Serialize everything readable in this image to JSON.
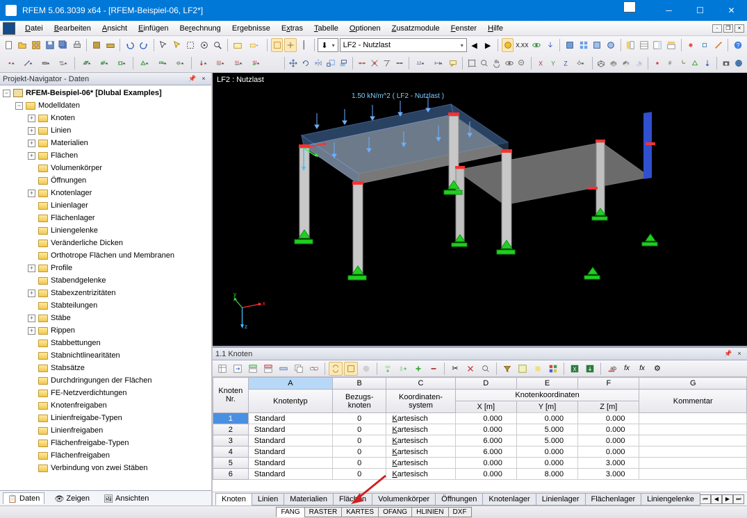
{
  "title": "RFEM 5.06.3039 x64 - [RFEM-Beispiel-06, LF2*]",
  "menus": [
    "Datei",
    "Bearbeiten",
    "Ansicht",
    "Einfügen",
    "Berechnung",
    "Ergebnisse",
    "Extras",
    "Tabelle",
    "Optionen",
    "Zusatzmodule",
    "Fenster",
    "Hilfe"
  ],
  "combo_load": "LF2 - Nutzlast",
  "nav_header": "Projekt-Navigator - Daten",
  "tree_root": "RFEM-Beispiel-06* [Dlubal Examples]",
  "tree_modelldaten": "Modelldaten",
  "tree_items": [
    {
      "label": "Knoten",
      "exp": "+"
    },
    {
      "label": "Linien",
      "exp": "+"
    },
    {
      "label": "Materialien",
      "exp": "+"
    },
    {
      "label": "Flächen",
      "exp": "+"
    },
    {
      "label": "Volumenkörper",
      "exp": ""
    },
    {
      "label": "Öffnungen",
      "exp": ""
    },
    {
      "label": "Knotenlager",
      "exp": "+"
    },
    {
      "label": "Linienlager",
      "exp": ""
    },
    {
      "label": "Flächenlager",
      "exp": ""
    },
    {
      "label": "Liniengelenke",
      "exp": ""
    },
    {
      "label": "Veränderliche Dicken",
      "exp": ""
    },
    {
      "label": "Orthotrope Flächen und Membranen",
      "exp": ""
    },
    {
      "label": "Profile",
      "exp": "+"
    },
    {
      "label": "Stabendgelenke",
      "exp": ""
    },
    {
      "label": "Stabexzentrizitäten",
      "exp": "+"
    },
    {
      "label": "Stabteilungen",
      "exp": ""
    },
    {
      "label": "Stäbe",
      "exp": "+"
    },
    {
      "label": "Rippen",
      "exp": "+"
    },
    {
      "label": "Stabbettungen",
      "exp": ""
    },
    {
      "label": "Stabnichtlinearitäten",
      "exp": ""
    },
    {
      "label": "Stabsätze",
      "exp": ""
    },
    {
      "label": "Durchdringungen der Flächen",
      "exp": ""
    },
    {
      "label": "FE-Netzverdichtungen",
      "exp": ""
    },
    {
      "label": "Knotenfreigaben",
      "exp": ""
    },
    {
      "label": "Linienfreigabe-Typen",
      "exp": ""
    },
    {
      "label": "Linienfreigaben",
      "exp": ""
    },
    {
      "label": "Flächenfreigabe-Typen",
      "exp": ""
    },
    {
      "label": "Flächenfreigaben",
      "exp": ""
    },
    {
      "label": "Verbindung von zwei Stäben",
      "exp": ""
    }
  ],
  "nav_tabs": [
    "Daten",
    "Zeigen",
    "Ansichten"
  ],
  "viewport_label": "LF2 : Nutzlast",
  "viewport_load_text": "1.50 kN/m^2 ( LF2 - Nutzlast )",
  "axis": {
    "x": "x",
    "y": "y",
    "z": "z"
  },
  "table_header": "1.1 Knoten",
  "table_columns": {
    "rowhdr": "Knoten\nNr.",
    "A_top": "A",
    "A": "Knotentyp",
    "B_top": "B",
    "B": "Bezugs-\nknoten",
    "C_top": "C",
    "C": "Koordinaten-\nsystem",
    "D_top": "D",
    "E_top": "E",
    "F_top": "F",
    "coord_group": "Knotenkoordinaten",
    "D": "X [m]",
    "E": "Y [m]",
    "F": "Z [m]",
    "G_top": "G",
    "G": "Kommentar"
  },
  "table_rows": [
    {
      "n": 1,
      "type": "Standard",
      "ref": "0",
      "sys": "Kartesisch",
      "x": "0.000",
      "y": "0.000",
      "z": "0.000",
      "c": ""
    },
    {
      "n": 2,
      "type": "Standard",
      "ref": "0",
      "sys": "Kartesisch",
      "x": "0.000",
      "y": "5.000",
      "z": "0.000",
      "c": ""
    },
    {
      "n": 3,
      "type": "Standard",
      "ref": "0",
      "sys": "Kartesisch",
      "x": "6.000",
      "y": "5.000",
      "z": "0.000",
      "c": ""
    },
    {
      "n": 4,
      "type": "Standard",
      "ref": "0",
      "sys": "Kartesisch",
      "x": "6.000",
      "y": "0.000",
      "z": "0.000",
      "c": ""
    },
    {
      "n": 5,
      "type": "Standard",
      "ref": "0",
      "sys": "Kartesisch",
      "x": "0.000",
      "y": "0.000",
      "z": "3.000",
      "c": ""
    },
    {
      "n": 6,
      "type": "Standard",
      "ref": "0",
      "sys": "Kartesisch",
      "x": "0.000",
      "y": "8.000",
      "z": "3.000",
      "c": ""
    }
  ],
  "table_tabs": [
    "Knoten",
    "Linien",
    "Materialien",
    "Flächen",
    "Volumenkörper",
    "Öffnungen",
    "Knotenlager",
    "Linienlager",
    "Flächenlager",
    "Liniengelenke"
  ],
  "status_tabs": [
    "FANG",
    "RASTER",
    "KARTES",
    "OFANG",
    "HLINIEN",
    "DXF"
  ]
}
